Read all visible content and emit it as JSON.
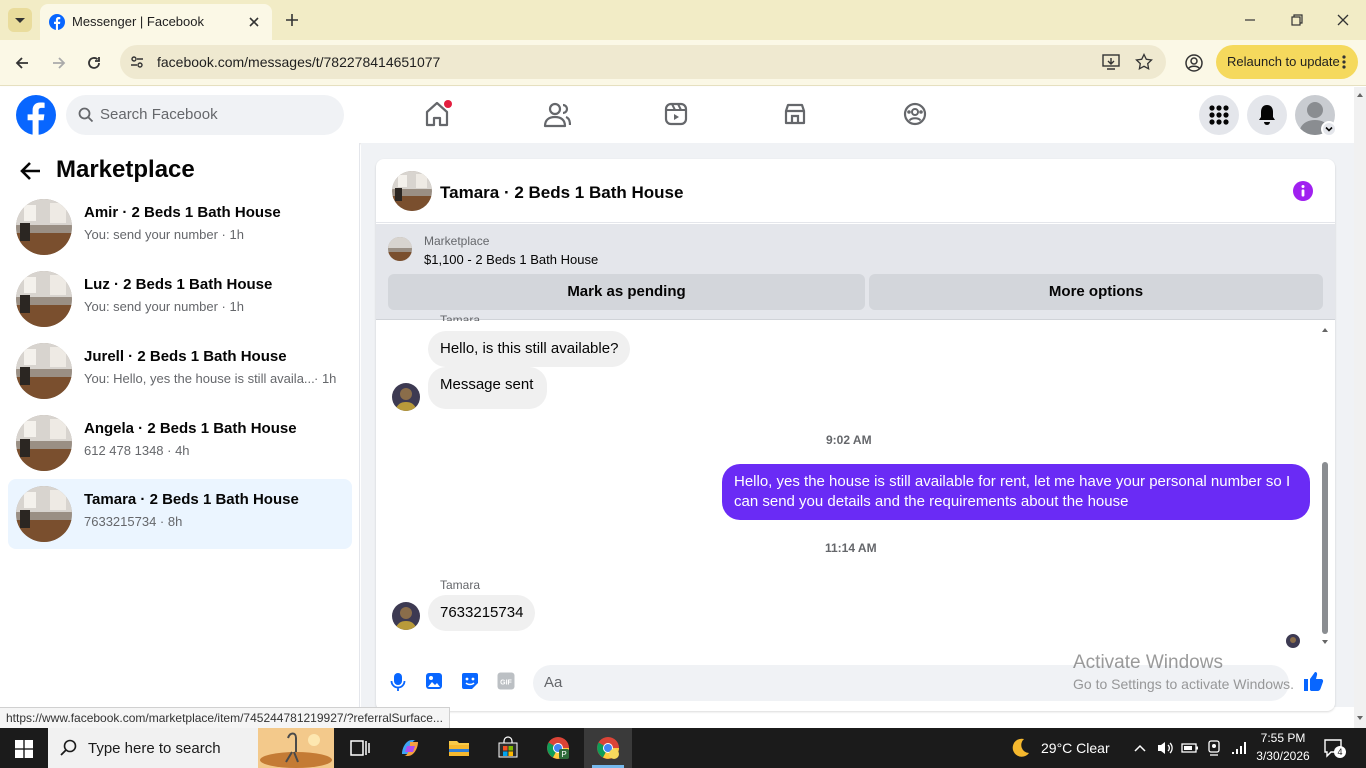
{
  "browser": {
    "tab_title": "Messenger | Facebook",
    "url": "facebook.com/messages/t/782278414651077",
    "relaunch_label": "Relaunch to update",
    "status_url": "https://www.facebook.com/marketplace/item/745244781219927/?referralSurface..."
  },
  "fb_header": {
    "search_placeholder": "Search Facebook"
  },
  "sidebar": {
    "title": "Marketplace",
    "conversations": [
      {
        "title": "Amir · 2 Beds 1 Bath House",
        "subtitle": "You: send your number · 1h"
      },
      {
        "title": "Luz · 2 Beds 1 Bath House",
        "subtitle": "You: send your number · 1h"
      },
      {
        "title": "Jurell · 2 Beds 1 Bath House",
        "subtitle": "You: Hello, yes the house is still availa...",
        "time": "· 1h"
      },
      {
        "title": "Angela · 2 Beds 1 Bath House",
        "subtitle": "612 478 1348 · 4h"
      },
      {
        "title": "Tamara · 2 Beds 1 Bath House",
        "subtitle": "7633215734 · 8h"
      }
    ]
  },
  "chat": {
    "title": "Tamara · 2 Beds 1 Bath House",
    "listing_source": "Marketplace",
    "listing_title": "$1,100 - 2 Beds 1 Bath House",
    "mark_pending_label": "Mark as pending",
    "more_options_label": "More options",
    "sender_name_top": "Tamara",
    "msg1": "Hello, is this still available?",
    "msg2": "Message sent",
    "stamp1": "9:02 AM",
    "my_msg": "Hello, yes the house is still available for rent, let me have your personal number so I can send you details and the requirements about the house",
    "stamp2": "11:14 AM",
    "sender_name": "Tamara",
    "msg3": "7633215734",
    "composer_placeholder": "Aa"
  },
  "watermark": {
    "line1": "Activate Windows",
    "line2": "Go to Settings to activate Windows."
  },
  "taskbar": {
    "search_placeholder": "Type here to search",
    "weather": "29°C  Clear",
    "time": "7:55 PM",
    "date": "3/30/2026",
    "notification_count": "4"
  },
  "colors": {
    "fb_blue": "#0866ff",
    "sent_bubble": "#6a2bf5",
    "relaunch_bg": "#f5d95d"
  }
}
